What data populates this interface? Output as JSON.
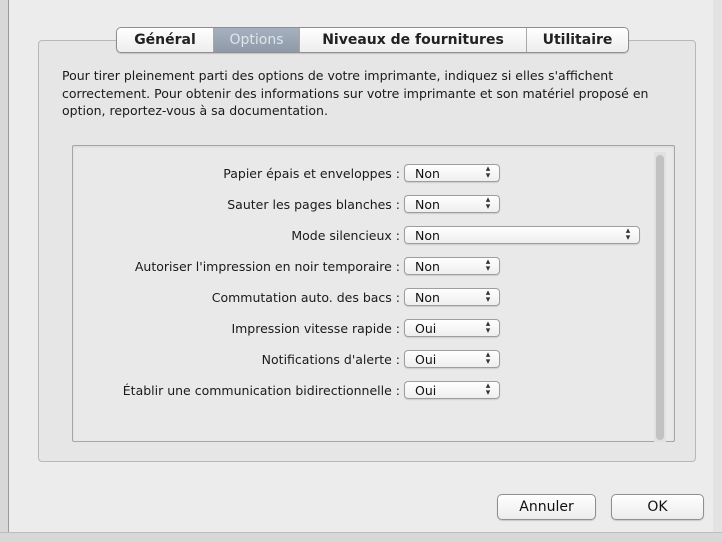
{
  "tabs": {
    "general": "Général",
    "options": "Options",
    "supplies": "Niveaux de fournitures",
    "utility": "Utilitaire"
  },
  "intro_text": "Pour tirer pleinement parti des options de votre imprimante, indiquez si elles s'affichent correctement. Pour obtenir des informations sur votre imprimante et son matériel proposé en option, reportez-vous à sa documentation.",
  "options": [
    {
      "label": "Papier épais et enveloppes :",
      "value": "Non"
    },
    {
      "label": "Sauter les pages blanches :",
      "value": "Non"
    },
    {
      "label": "Mode silencieux :",
      "value": "Non"
    },
    {
      "label": "Autoriser l'impression en noir temporaire :",
      "value": "Non"
    },
    {
      "label": "Commutation auto. des bacs :",
      "value": "Non"
    },
    {
      "label": "Impression vitesse rapide :",
      "value": "Oui"
    },
    {
      "label": "Notifications d'alerte :",
      "value": "Oui"
    },
    {
      "label": "Établir une communication bidirectionnelle :",
      "value": "Oui"
    }
  ],
  "buttons": {
    "cancel": "Annuler",
    "ok": "OK"
  },
  "icons": {
    "popup_arrows": "updown-chevron-icon"
  }
}
